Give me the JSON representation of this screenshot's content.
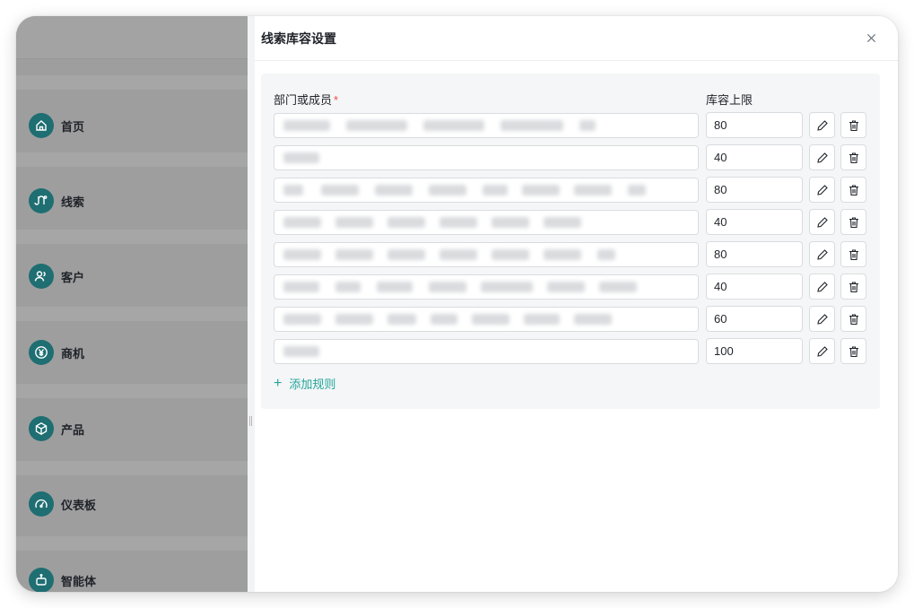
{
  "sidebar": {
    "items": [
      {
        "label": "首页",
        "icon": "home-icon"
      },
      {
        "label": "线索",
        "icon": "route-icon"
      },
      {
        "label": "客户",
        "icon": "users-icon"
      },
      {
        "label": "商机",
        "icon": "yen-icon"
      },
      {
        "label": "产品",
        "icon": "box-icon"
      },
      {
        "label": "仪表板",
        "icon": "gauge-icon"
      },
      {
        "label": "智能体",
        "icon": "robot-icon"
      }
    ]
  },
  "panel": {
    "title": "线索库容设置",
    "close_icon": "close-icon",
    "columns": {
      "member": "部门或成员",
      "required_mark": "*",
      "limit": "库容上限"
    },
    "rules": [
      {
        "limit": "80",
        "members": "blurred"
      },
      {
        "limit": "40",
        "members": "blurred"
      },
      {
        "limit": "80",
        "members": "blurred"
      },
      {
        "limit": "40",
        "members": "blurred"
      },
      {
        "limit": "80",
        "members": "blurred"
      },
      {
        "limit": "40",
        "members": "blurred"
      },
      {
        "limit": "60",
        "members": "blurred"
      },
      {
        "limit": "100",
        "members": "blurred"
      }
    ],
    "add_rule": {
      "plus": "+",
      "label": "添加规则"
    }
  },
  "colors": {
    "accent": "#23a59a",
    "nav_icon_bg": "#1e6e72",
    "required": "#f54a45"
  }
}
